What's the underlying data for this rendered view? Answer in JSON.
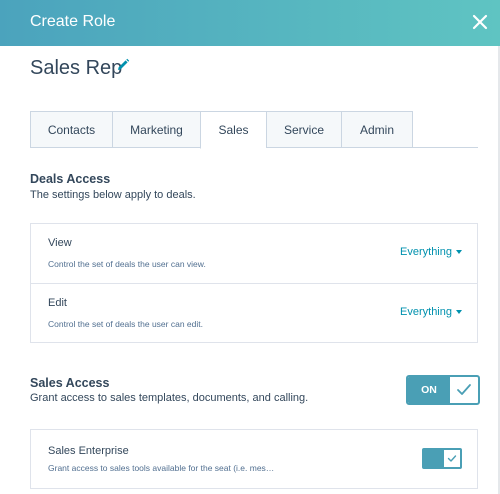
{
  "header": {
    "title": "Create Role"
  },
  "role": {
    "name": "Sales Rep"
  },
  "tabs": [
    {
      "label": "Contacts"
    },
    {
      "label": "Marketing"
    },
    {
      "label": "Sales"
    },
    {
      "label": "Service"
    },
    {
      "label": "Admin"
    }
  ],
  "active_tab": "Sales",
  "deals_access": {
    "title": "Deals Access",
    "description": "The settings below apply to deals.",
    "rows": [
      {
        "title": "View",
        "description": "Control the set of deals the user can view.",
        "value": "Everything"
      },
      {
        "title": "Edit",
        "description": "Control the set of deals the user can edit.",
        "value": "Everything"
      }
    ]
  },
  "sales_access": {
    "title": "Sales Access",
    "description": "Grant access to sales templates, documents, and calling.",
    "toggle_label": "ON",
    "enabled": true
  },
  "sales_enterprise": {
    "title": "Sales Enterprise",
    "description": "Grant access to sales tools available for the seat (i.e. mes…",
    "enabled": true
  },
  "colors": {
    "accent": "#4a9fb5",
    "link": "#0091ae",
    "text": "#33475b",
    "header_gradient_start": "#4ba3bd",
    "header_gradient_end": "#5fc4c2"
  }
}
